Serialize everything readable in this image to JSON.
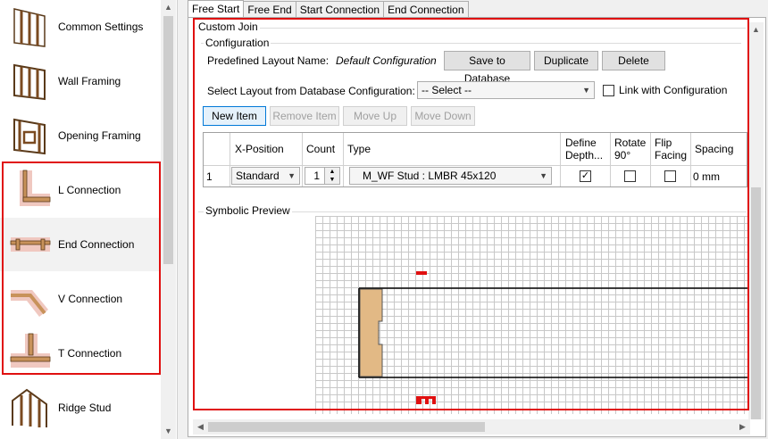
{
  "sidebar": {
    "items": [
      {
        "label": "Common Settings",
        "icon": "wall-panel-icon"
      },
      {
        "label": "Wall Framing",
        "icon": "wall-framing-icon"
      },
      {
        "label": "Opening Framing",
        "icon": "opening-framing-icon"
      },
      {
        "label": "L Connection",
        "icon": "l-connection-icon"
      },
      {
        "label": "End Connection",
        "icon": "end-connection-icon"
      },
      {
        "label": "V Connection",
        "icon": "v-connection-icon"
      },
      {
        "label": "T Connection",
        "icon": "t-connection-icon"
      },
      {
        "label": "Ridge Stud",
        "icon": "ridge-stud-icon"
      }
    ]
  },
  "tabs": [
    "Free Start",
    "Free End",
    "Start Connection",
    "End Connection"
  ],
  "custom_join": {
    "title": "Custom Join",
    "configuration": {
      "title": "Configuration",
      "predefined_label": "Predefined Layout Name:",
      "predefined_value": "Default Configuration",
      "save_button": "Save to Database",
      "duplicate_button": "Duplicate",
      "delete_button": "Delete",
      "select_label": "Select Layout from Database Configuration:",
      "select_value": "-- Select --",
      "link_label": "Link with Configuration",
      "link_checked": false
    },
    "toolbar": {
      "new_item": "New Item",
      "remove_item": "Remove Item",
      "move_up": "Move Up",
      "move_down": "Move Down"
    },
    "table": {
      "headers": [
        "X-Position",
        "Count",
        "Type",
        "Define Depth...",
        "Rotate 90°",
        "Flip Facing",
        "Spacing"
      ],
      "rows": [
        {
          "index": "1",
          "x_position": "Standard",
          "count": "1",
          "type": "M_WF Stud : LMBR 45x120",
          "define_depth": true,
          "rotate_90": false,
          "flip_facing": false,
          "spacing": "0 mm"
        }
      ]
    },
    "preview": {
      "title": "Symbolic Preview"
    }
  },
  "colors": {
    "highlight": "#e01010",
    "stud": "#e2b985",
    "accent": "#0078d7"
  }
}
